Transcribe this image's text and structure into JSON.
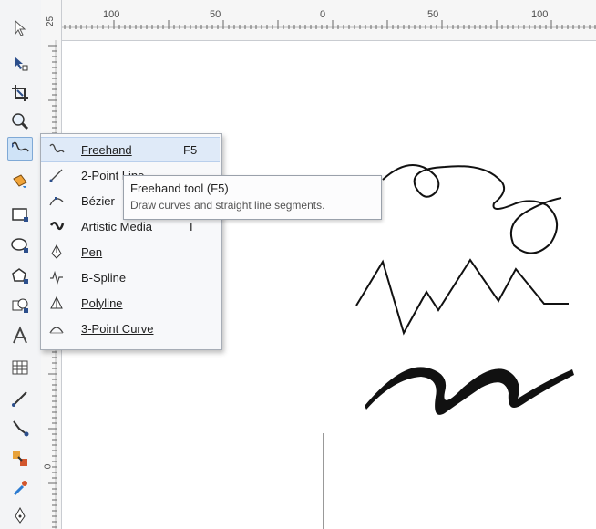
{
  "ruler": {
    "h_labels": [
      "100",
      "50",
      "0",
      "50",
      "100"
    ],
    "v_labels": [
      "25",
      "0"
    ]
  },
  "toolbox": {
    "tools": [
      {
        "name": "pick-tool",
        "icon": "arrow-icon"
      },
      {
        "name": "shape-tool",
        "icon": "shape-edit-icon"
      },
      {
        "name": "crop-tool",
        "icon": "crop-icon"
      },
      {
        "name": "zoom-tool",
        "icon": "magnifier-icon"
      },
      {
        "name": "freehand-tool",
        "icon": "freehand-curve-icon",
        "active": true
      },
      {
        "name": "smart-fill-tool",
        "icon": "bucket-icon"
      },
      {
        "name": "rectangle-tool",
        "icon": "rectangle-icon"
      },
      {
        "name": "ellipse-tool",
        "icon": "ellipse-icon"
      },
      {
        "name": "polygon-tool",
        "icon": "polygon-icon"
      },
      {
        "name": "basic-shapes-tool",
        "icon": "basic-shapes-icon"
      },
      {
        "name": "text-tool",
        "icon": "text-a-icon"
      },
      {
        "name": "table-tool",
        "icon": "table-icon"
      },
      {
        "name": "dimension-tool",
        "icon": "dimension-icon"
      },
      {
        "name": "connector-tool",
        "icon": "connector-icon"
      },
      {
        "name": "interactive-tool",
        "icon": "blend-icon"
      },
      {
        "name": "eyedropper-tool",
        "icon": "eyedropper-icon"
      },
      {
        "name": "outline-tool",
        "icon": "pen-nib-icon"
      }
    ]
  },
  "flyout": {
    "items": [
      {
        "label": "Freehand",
        "shortcut": "F5",
        "icon": "freehand-icon"
      },
      {
        "label": "2-Point Line",
        "shortcut": "",
        "icon": "two-point-line-icon"
      },
      {
        "label": "Bézier",
        "shortcut": "",
        "icon": "bezier-icon"
      },
      {
        "label": "Artistic Media",
        "shortcut": "I",
        "icon": "artistic-media-icon"
      },
      {
        "label": "Pen",
        "shortcut": "",
        "icon": "pen-icon"
      },
      {
        "label": "B-Spline",
        "shortcut": "",
        "icon": "b-spline-icon"
      },
      {
        "label": "Polyline",
        "shortcut": "",
        "icon": "polyline-icon"
      },
      {
        "label": "3-Point Curve",
        "shortcut": "",
        "icon": "three-point-curve-icon"
      }
    ]
  },
  "tooltip": {
    "title": "Freehand tool (F5)",
    "description": "Draw curves and straight line segments."
  },
  "colors": {
    "toolbox_bg": "#f3f4f6",
    "highlight": "#dfeaf8",
    "stroke": "#111111"
  }
}
